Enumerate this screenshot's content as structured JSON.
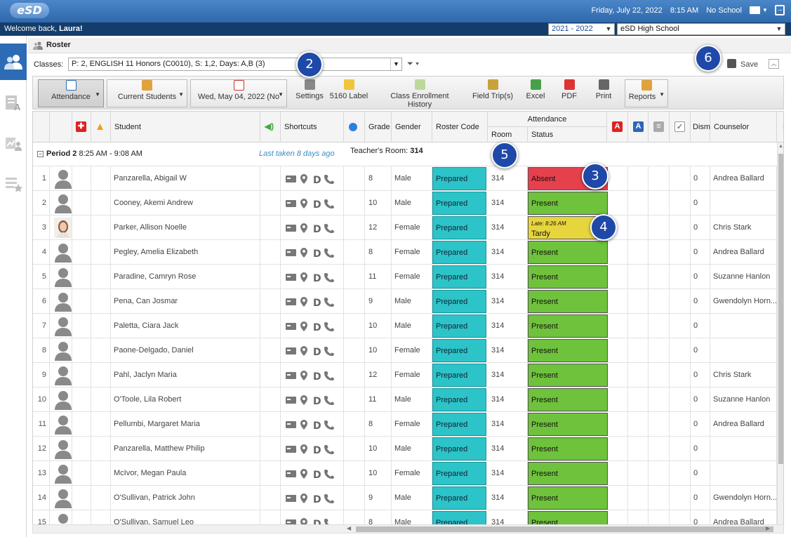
{
  "header": {
    "logo": "eSD",
    "date": "Friday, July 22, 2022",
    "time": "8:15 AM",
    "school_status": "No School"
  },
  "welcome": {
    "prefix": "Welcome back, ",
    "name": "Laura!"
  },
  "year_select": "2021 - 2022",
  "school_select": "eSD High School",
  "panel": {
    "title": "Roster"
  },
  "classes": {
    "label": "Classes:",
    "value": "P: 2, ENGLISH 11 Honors (C0010), S: 1,2, Days: A,B (3)"
  },
  "save_label": "Save",
  "toolbar": {
    "attendance": "Attendance",
    "current_students": "Current Students",
    "date": "Wed, May 04, 2022 (No",
    "settings": "Settings",
    "label5160": "5160 Label",
    "class_enrollment_history": "Class Enrollment History",
    "field_trips": "Field Trip(s)",
    "excel": "Excel",
    "pdf": "PDF",
    "print": "Print",
    "reports": "Reports"
  },
  "columns": {
    "student": "Student",
    "shortcuts": "Shortcuts",
    "grade": "Grade",
    "gender": "Gender",
    "roster_code": "Roster Code",
    "attendance": "Attendance",
    "room": "Room",
    "status": "Status",
    "dism": "Dism",
    "counselor": "Counselor",
    "last": "L"
  },
  "period": {
    "label": "Period 2",
    "time": "8:25 AM - 9:08 AM",
    "last_taken": "Last taken 8 days ago",
    "teacher_room_label": "Teacher's Room:",
    "teacher_room": "314"
  },
  "rows": [
    {
      "n": "1",
      "name": "Panzarella, Abigail W",
      "grade": "8",
      "gender": "Male",
      "code": "Prepared",
      "room": "314",
      "status": "Absent",
      "dism": "0",
      "counselor": "Andrea Ballard"
    },
    {
      "n": "2",
      "name": "Cooney, Akemi Andrew",
      "grade": "10",
      "gender": "Male",
      "code": "Prepared",
      "room": "314",
      "status": "Present",
      "dism": "0",
      "counselor": ""
    },
    {
      "n": "3",
      "name": "Parker, Allison Noelle",
      "grade": "12",
      "gender": "Female",
      "code": "Prepared",
      "room": "314",
      "status": "Tardy",
      "late": "Late: 8:26 AM",
      "dism": "0",
      "counselor": "Chris Stark"
    },
    {
      "n": "4",
      "name": "Pegley, Amelia Elizabeth",
      "grade": "8",
      "gender": "Female",
      "code": "Prepared",
      "room": "314",
      "status": "Present",
      "dism": "0",
      "counselor": "Andrea Ballard"
    },
    {
      "n": "5",
      "name": "Paradine, Camryn Rose",
      "grade": "11",
      "gender": "Female",
      "code": "Prepared",
      "room": "314",
      "status": "Present",
      "dism": "0",
      "counselor": "Suzanne Hanlon"
    },
    {
      "n": "6",
      "name": "Pena, Can Josmar",
      "grade": "9",
      "gender": "Male",
      "code": "Prepared",
      "room": "314",
      "status": "Present",
      "dism": "0",
      "counselor": "Gwendolyn Horn..."
    },
    {
      "n": "7",
      "name": "Paletta, Ciara Jack",
      "grade": "10",
      "gender": "Male",
      "code": "Prepared",
      "room": "314",
      "status": "Present",
      "dism": "0",
      "counselor": ""
    },
    {
      "n": "8",
      "name": "Paone-Delgado, Daniel",
      "grade": "10",
      "gender": "Female",
      "code": "Prepared",
      "room": "314",
      "status": "Present",
      "dism": "0",
      "counselor": ""
    },
    {
      "n": "9",
      "name": "Pahl, Jaclyn Maria",
      "grade": "12",
      "gender": "Female",
      "code": "Prepared",
      "room": "314",
      "status": "Present",
      "dism": "0",
      "counselor": "Chris Stark"
    },
    {
      "n": "10",
      "name": "O'Toole, Lila Robert",
      "grade": "11",
      "gender": "Male",
      "code": "Prepared",
      "room": "314",
      "status": "Present",
      "dism": "0",
      "counselor": "Suzanne Hanlon"
    },
    {
      "n": "11",
      "name": "Pellumbi, Margaret Maria",
      "grade": "8",
      "gender": "Female",
      "code": "Prepared",
      "room": "314",
      "status": "Present",
      "dism": "0",
      "counselor": "Andrea Ballard"
    },
    {
      "n": "12",
      "name": "Panzarella, Matthew Philip",
      "grade": "10",
      "gender": "Male",
      "code": "Prepared",
      "room": "314",
      "status": "Present",
      "dism": "0",
      "counselor": ""
    },
    {
      "n": "13",
      "name": "McIvor, Megan Paula",
      "grade": "10",
      "gender": "Female",
      "code": "Prepared",
      "room": "314",
      "status": "Present",
      "dism": "0",
      "counselor": ""
    },
    {
      "n": "14",
      "name": "O'Sullivan, Patrick John",
      "grade": "9",
      "gender": "Male",
      "code": "Prepared",
      "room": "314",
      "status": "Present",
      "dism": "0",
      "counselor": "Gwendolyn Horn..."
    },
    {
      "n": "15",
      "name": "O'Sullivan, Samuel Leo",
      "grade": "8",
      "gender": "Male",
      "code": "Prepared",
      "room": "314",
      "status": "Present",
      "dism": "0",
      "counselor": "Andrea Ballard"
    }
  ],
  "callouts": [
    "2",
    "3",
    "4",
    "5",
    "6"
  ],
  "colors": {
    "present": "#6fc23b",
    "absent": "#e4414d",
    "tardy": "#e7d53e",
    "prepared": "#2cc4c8",
    "accent": "#2d6cb5"
  }
}
